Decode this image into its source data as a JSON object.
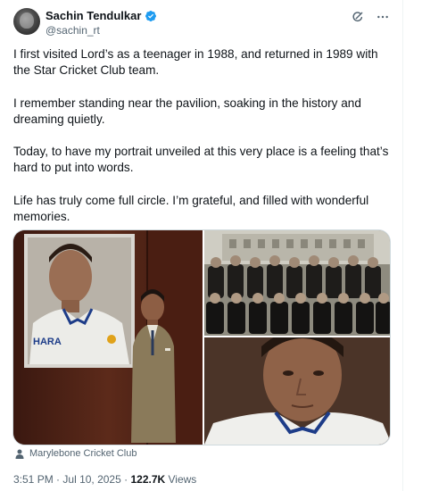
{
  "author": {
    "display_name": "Sachin Tendulkar",
    "handle": "@sachin_rt",
    "verified": true,
    "avatar_icon": "profile-photo"
  },
  "header_actions": [
    {
      "icon": "grok-icon"
    },
    {
      "icon": "more-icon"
    }
  ],
  "post": {
    "paragraphs": [
      "I first visited Lord’s as a teenager in 1988, and returned in 1989 with the Star Cricket Club team.",
      "I remember standing near the pavilion, soaking in the history and dreaming quietly.",
      "Today, to have my portrait unveiled at this very place is a feeling that’s hard to put into words.",
      "Life has truly come full circle. I’m grateful, and filled with wonderful memories."
    ]
  },
  "media": {
    "tiles": [
      {
        "id": "portrait-unveiling"
      },
      {
        "id": "team-photo"
      },
      {
        "id": "portrait-closeup"
      }
    ],
    "portrait_jersey_text": "HARA"
  },
  "caption": {
    "icon": "person-icon",
    "text": "Marylebone Cricket Club"
  },
  "meta": {
    "time": "3:51 PM",
    "separator": "·",
    "date": "Jul 10, 2025",
    "views_count": "122.7K",
    "views_label": "Views"
  },
  "colors": {
    "verified": "#1d9bf0",
    "secondary_text": "#536471",
    "primary_text": "#0f1419",
    "border": "#cfd9de"
  }
}
